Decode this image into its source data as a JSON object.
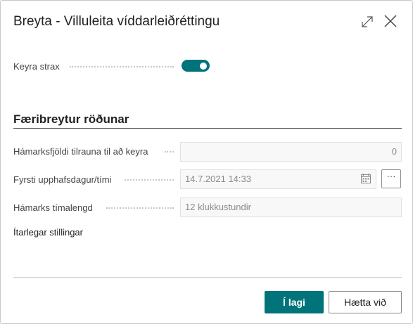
{
  "dialog": {
    "title": "Breyta - Villuleita víddarleiðréttingu"
  },
  "run_now": {
    "label": "Keyra strax",
    "enabled": true
  },
  "section": {
    "title": "Færibreytur röðunar"
  },
  "fields": {
    "max_attempts": {
      "label": "Hámarksfjöldi tilrauna til að keyra",
      "value": "0"
    },
    "first_start": {
      "label": "Fyrsti upphafsdagur/tími",
      "value": "14.7.2021 14:33",
      "more_label": "···"
    },
    "max_duration": {
      "label": "Hámarks tímalengd",
      "placeholder": "12 klukkustundir"
    }
  },
  "advanced_link": "Ítarlegar stillingar",
  "buttons": {
    "ok": "Í lagi",
    "cancel": "Hætta við"
  },
  "colors": {
    "accent": "#00747a"
  }
}
